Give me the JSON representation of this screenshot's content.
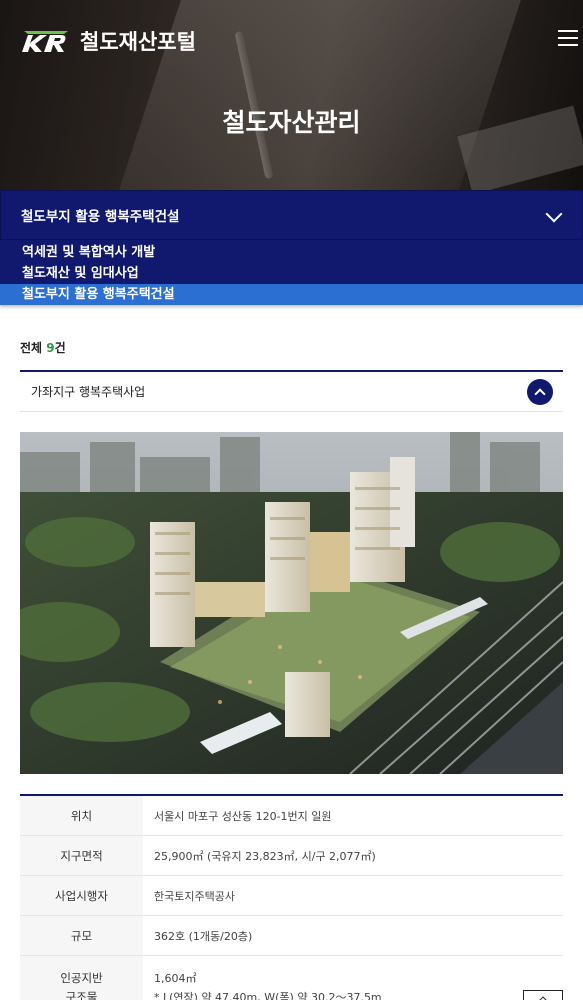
{
  "header": {
    "logo_text": "철도재산포털",
    "menu_icon": "hamburger-icon",
    "page_title": "철도자산관리"
  },
  "category_select": {
    "selected": "철도부지 활용 행복주택건설",
    "options": [
      "역세권 및 복합역사 개발",
      "철도재산 및 임대사업",
      "철도부지 활용 행복주택건설"
    ]
  },
  "total": {
    "prefix": "전체 ",
    "count": "9",
    "suffix": "건"
  },
  "project": {
    "title": "가좌지구 행복주택사업",
    "toggle_icon": "chevron-up-icon",
    "image_alt": "rendering-image",
    "rows": [
      {
        "label": "위치",
        "value": "서울시 마포구 성산동 120-1번지 일원"
      },
      {
        "label": "지구면적",
        "value": "25,900㎡ (국유지 23,823㎡, 시/구 2,077㎡)"
      },
      {
        "label": "사업시행자",
        "value": "한국토지주택공사"
      },
      {
        "label": "규모",
        "value": "362호 (1개동/20층)"
      }
    ],
    "structure": {
      "label_line1": "인공지반",
      "label_line2": "구조물",
      "value_line1": "1,604㎡",
      "value_line2": "* L(연장) 약 47.40m, W(폭) 약 30.2～37.5m"
    }
  },
  "colors": {
    "navy": "#11196e",
    "active_blue": "#2a6fd1",
    "count_green": "#2b9a3a"
  }
}
